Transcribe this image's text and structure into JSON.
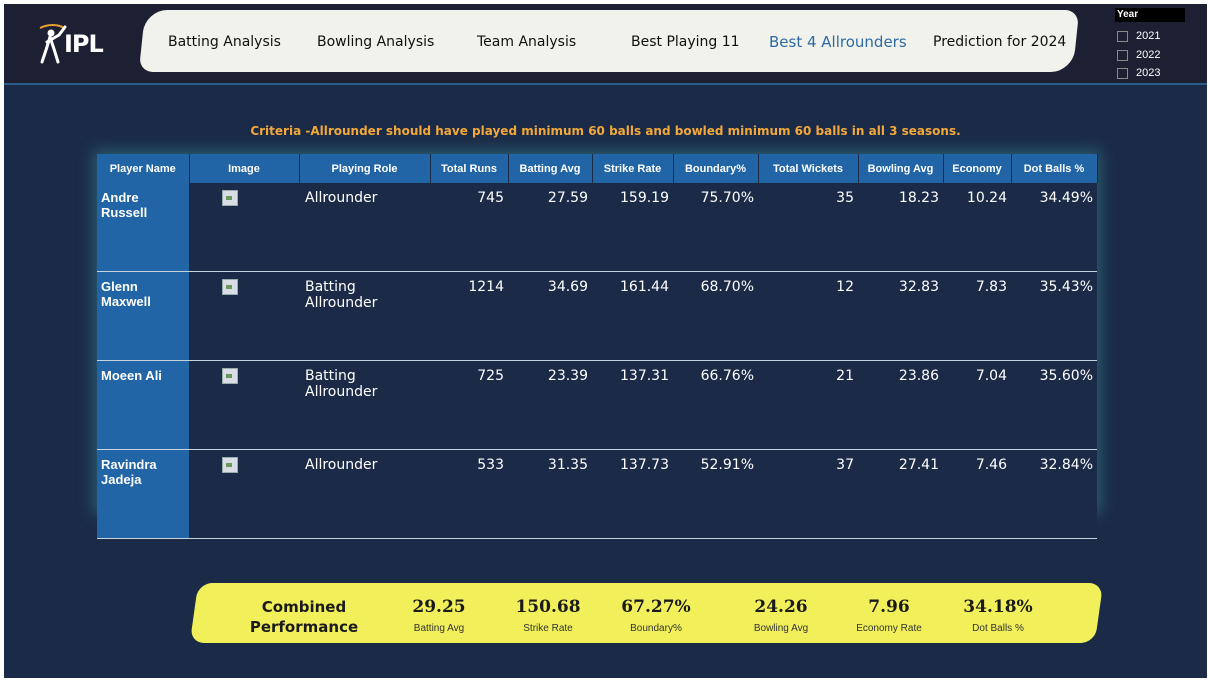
{
  "logo": {
    "text": "IPL"
  },
  "nav": {
    "items": [
      {
        "label": "Batting Analysis"
      },
      {
        "label": "Bowling Analysis"
      },
      {
        "label": "Team Analysis"
      },
      {
        "label": "Best Playing 11"
      },
      {
        "label": "Best 4 Allrounders",
        "active": true
      },
      {
        "label": "Prediction for 2024"
      }
    ]
  },
  "year_slicer": {
    "title": "Year",
    "options": [
      {
        "label": "2021",
        "checked": false
      },
      {
        "label": "2022",
        "checked": false
      },
      {
        "label": "2023",
        "checked": false
      }
    ]
  },
  "criteria": "Criteria -Allrounder should have played minimum 60 balls and bowled minimum 60 balls in all 3 seasons.",
  "table": {
    "headers": [
      "Player Name",
      "Image",
      "Playing Role",
      "Total Runs",
      "Batting Avg",
      "Strike Rate",
      "Boundary%",
      "Total Wickets",
      "Bowling Avg",
      "Economy",
      "Dot Balls %"
    ],
    "rows": [
      {
        "name_l1": "Andre",
        "name_l2": "Russell",
        "role": "Allrounder",
        "runs": "745",
        "bat_avg": "27.59",
        "sr": "159.19",
        "boundary": "75.70%",
        "wickets": "35",
        "bowl_avg": "18.23",
        "economy": "10.24",
        "dot": "34.49%"
      },
      {
        "name_l1": "Glenn",
        "name_l2": "Maxwell",
        "role": "Batting Allrounder",
        "runs": "1214",
        "bat_avg": "34.69",
        "sr": "161.44",
        "boundary": "68.70%",
        "wickets": "12",
        "bowl_avg": "32.83",
        "economy": "7.83",
        "dot": "35.43%"
      },
      {
        "name_l1": "Moeen Ali",
        "name_l2": "",
        "role": "Batting Allrounder",
        "runs": "725",
        "bat_avg": "23.39",
        "sr": "137.31",
        "boundary": "66.76%",
        "wickets": "21",
        "bowl_avg": "23.86",
        "economy": "7.04",
        "dot": "35.60%"
      },
      {
        "name_l1": "Ravindra",
        "name_l2": "Jadeja",
        "role": "Allrounder",
        "runs": "533",
        "bat_avg": "31.35",
        "sr": "137.73",
        "boundary": "52.91%",
        "wickets": "37",
        "bowl_avg": "27.41",
        "economy": "7.46",
        "dot": "32.84%"
      }
    ]
  },
  "combined": {
    "title_l1": "Combined",
    "title_l2": "Performance",
    "metrics": [
      {
        "value": "29.25",
        "label": "Batting Avg"
      },
      {
        "value": "150.68",
        "label": "Strike Rate"
      },
      {
        "value": "67.27%",
        "label": "Boundary%"
      },
      {
        "value": "24.26",
        "label": "Bowling Avg"
      },
      {
        "value": "7.96",
        "label": "Economy Rate"
      },
      {
        "value": "34.18%",
        "label": "Dot Balls %"
      }
    ]
  },
  "colors": {
    "background": "#1b2b47",
    "header_blue": "#2165a6",
    "accent_orange": "#f2a83b",
    "panel_yellow": "#f2f05a",
    "active_nav": "#2d6aa3"
  }
}
